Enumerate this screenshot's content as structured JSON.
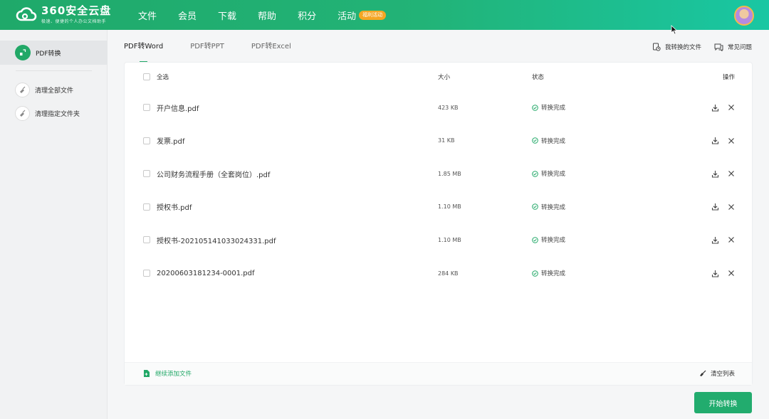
{
  "header": {
    "logo_title": "360安全云盘",
    "logo_subtitle": "极速、便捷的个人办公文档助手",
    "nav": [
      {
        "label": "文件"
      },
      {
        "label": "会员"
      },
      {
        "label": "下载"
      },
      {
        "label": "帮助"
      },
      {
        "label": "积分"
      },
      {
        "label": "活动"
      }
    ],
    "activity_badge": "福利活动"
  },
  "sidebar": {
    "active": {
      "label": "PDF转换"
    },
    "items": [
      {
        "label": "清理全部文件"
      },
      {
        "label": "清理指定文件夹"
      }
    ]
  },
  "tabs": [
    {
      "label": "PDF转Word",
      "active": true
    },
    {
      "label": "PDF转PPT",
      "active": false
    },
    {
      "label": "PDF转Excel",
      "active": false
    }
  ],
  "top_links": {
    "my_files": "我转换的文件",
    "faq": "常见问题"
  },
  "table": {
    "headers": {
      "select_all": "全选",
      "size": "大小",
      "status": "状态",
      "ops": "操作"
    },
    "rows": [
      {
        "name": "开户信息.pdf",
        "size": "423 KB",
        "status": "转换完成"
      },
      {
        "name": "发票.pdf",
        "size": "31 KB",
        "status": "转换完成"
      },
      {
        "name": "公司财务流程手册（全套岗位）.pdf",
        "size": "1.85 MB",
        "status": "转换完成"
      },
      {
        "name": "授权书.pdf",
        "size": "1.10 MB",
        "status": "转换完成"
      },
      {
        "name": "授权书-20210514103302433​1.pdf",
        "size": "1.10 MB",
        "status": "转换完成"
      },
      {
        "name": "20200603181234-0001.pdf",
        "size": "284 KB",
        "status": "转换完成"
      }
    ]
  },
  "footer": {
    "add_more": "继续添加文件",
    "clear_list": "清空列表"
  },
  "start_button": "开始转换",
  "colors": {
    "brand": "#21a867",
    "badge": "#f5a623"
  }
}
